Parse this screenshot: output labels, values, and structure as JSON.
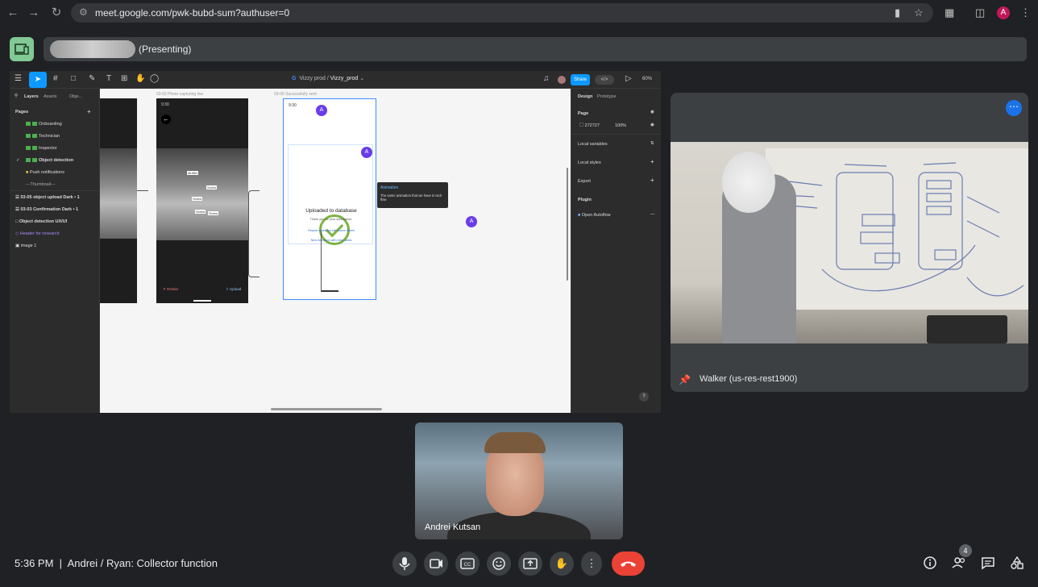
{
  "browser": {
    "url": "meet.google.com/pwk-bubd-sum?authuser=0",
    "profile_initial": "A"
  },
  "presentation": {
    "presenting_label": "(Presenting)"
  },
  "figma": {
    "project": "Vizzy prod",
    "file": "Vizzy_prod",
    "share_label": "Share",
    "zoom": "60%",
    "tabs": {
      "layers": "Layers",
      "assets": "Assets",
      "object": "Obje..."
    },
    "pages_heading": "Pages",
    "pages": [
      "Onboarding",
      "Technician",
      "Inspector",
      "Object detection",
      "Push notifications",
      "---Thumbnail---"
    ],
    "layers": [
      {
        "label": "03-05 object upload",
        "badge": "Dark • 1"
      },
      {
        "label": "03-03 Confirmation",
        "badge": "Dark • 1"
      },
      {
        "label": "Object detection UX/UI",
        "badge": ""
      },
      {
        "label": "Header for research",
        "badge": ""
      },
      {
        "label": "image 1",
        "badge": ""
      }
    ],
    "canvas": {
      "frame1_label": "03-02 Photo capturing live",
      "frame2_label": "03-06 Successfully sent",
      "phone_time": "9:30",
      "uploaded_title": "Uploaded to database",
      "uploaded_sub": "Thank you for your submission.",
      "link1": "Repeat detection with same labels",
      "link2": "New detection with new labels",
      "retake": "Retake",
      "upload": "Upload",
      "tooltip_title": "Animation",
      "tooltip_body": "The same animation that we have in tech flow",
      "chips": [
        "Muffler",
        "Screw",
        "Screw",
        "Screw",
        "Screw"
      ],
      "cursor_initial": "A"
    },
    "right": {
      "tab_design": "Design",
      "tab_prototype": "Prototype",
      "page_heading": "Page",
      "page_color": "272727",
      "page_opacity": "100%",
      "local_variables": "Local variables",
      "local_styles": "Local styles",
      "export": "Export",
      "plugin": "Plugin",
      "plugin_name": "Open Autoflow"
    },
    "help": "?"
  },
  "tiles": {
    "walker_name": "Walker (us-res-rest1900)",
    "andrei_name": "Andrei Kutsan"
  },
  "footer": {
    "time": "5:36 PM",
    "separator": "|",
    "meeting_title": "Andrei / Ryan: Collector function",
    "people_count": "4"
  },
  "colors": {
    "hangup": "#ea4335",
    "present_icon": "#81c995",
    "figma_blue": "#0d99ff",
    "check_green": "#7cb342"
  }
}
